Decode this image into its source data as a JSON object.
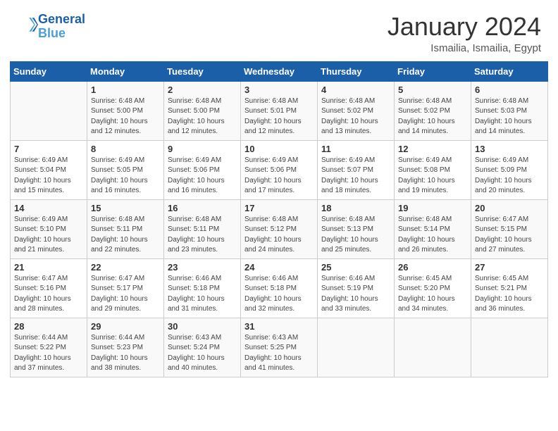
{
  "header": {
    "logo_line1": "General",
    "logo_line2": "Blue",
    "month": "January 2024",
    "location": "Ismailia, Ismailia, Egypt"
  },
  "days_of_week": [
    "Sunday",
    "Monday",
    "Tuesday",
    "Wednesday",
    "Thursday",
    "Friday",
    "Saturday"
  ],
  "weeks": [
    [
      {
        "num": "",
        "info": ""
      },
      {
        "num": "1",
        "info": "Sunrise: 6:48 AM\nSunset: 5:00 PM\nDaylight: 10 hours\nand 12 minutes."
      },
      {
        "num": "2",
        "info": "Sunrise: 6:48 AM\nSunset: 5:00 PM\nDaylight: 10 hours\nand 12 minutes."
      },
      {
        "num": "3",
        "info": "Sunrise: 6:48 AM\nSunset: 5:01 PM\nDaylight: 10 hours\nand 12 minutes."
      },
      {
        "num": "4",
        "info": "Sunrise: 6:48 AM\nSunset: 5:02 PM\nDaylight: 10 hours\nand 13 minutes."
      },
      {
        "num": "5",
        "info": "Sunrise: 6:48 AM\nSunset: 5:02 PM\nDaylight: 10 hours\nand 14 minutes."
      },
      {
        "num": "6",
        "info": "Sunrise: 6:48 AM\nSunset: 5:03 PM\nDaylight: 10 hours\nand 14 minutes."
      }
    ],
    [
      {
        "num": "7",
        "info": "Sunrise: 6:49 AM\nSunset: 5:04 PM\nDaylight: 10 hours\nand 15 minutes."
      },
      {
        "num": "8",
        "info": "Sunrise: 6:49 AM\nSunset: 5:05 PM\nDaylight: 10 hours\nand 16 minutes."
      },
      {
        "num": "9",
        "info": "Sunrise: 6:49 AM\nSunset: 5:06 PM\nDaylight: 10 hours\nand 16 minutes."
      },
      {
        "num": "10",
        "info": "Sunrise: 6:49 AM\nSunset: 5:06 PM\nDaylight: 10 hours\nand 17 minutes."
      },
      {
        "num": "11",
        "info": "Sunrise: 6:49 AM\nSunset: 5:07 PM\nDaylight: 10 hours\nand 18 minutes."
      },
      {
        "num": "12",
        "info": "Sunrise: 6:49 AM\nSunset: 5:08 PM\nDaylight: 10 hours\nand 19 minutes."
      },
      {
        "num": "13",
        "info": "Sunrise: 6:49 AM\nSunset: 5:09 PM\nDaylight: 10 hours\nand 20 minutes."
      }
    ],
    [
      {
        "num": "14",
        "info": "Sunrise: 6:49 AM\nSunset: 5:10 PM\nDaylight: 10 hours\nand 21 minutes."
      },
      {
        "num": "15",
        "info": "Sunrise: 6:48 AM\nSunset: 5:11 PM\nDaylight: 10 hours\nand 22 minutes."
      },
      {
        "num": "16",
        "info": "Sunrise: 6:48 AM\nSunset: 5:11 PM\nDaylight: 10 hours\nand 23 minutes."
      },
      {
        "num": "17",
        "info": "Sunrise: 6:48 AM\nSunset: 5:12 PM\nDaylight: 10 hours\nand 24 minutes."
      },
      {
        "num": "18",
        "info": "Sunrise: 6:48 AM\nSunset: 5:13 PM\nDaylight: 10 hours\nand 25 minutes."
      },
      {
        "num": "19",
        "info": "Sunrise: 6:48 AM\nSunset: 5:14 PM\nDaylight: 10 hours\nand 26 minutes."
      },
      {
        "num": "20",
        "info": "Sunrise: 6:47 AM\nSunset: 5:15 PM\nDaylight: 10 hours\nand 27 minutes."
      }
    ],
    [
      {
        "num": "21",
        "info": "Sunrise: 6:47 AM\nSunset: 5:16 PM\nDaylight: 10 hours\nand 28 minutes."
      },
      {
        "num": "22",
        "info": "Sunrise: 6:47 AM\nSunset: 5:17 PM\nDaylight: 10 hours\nand 29 minutes."
      },
      {
        "num": "23",
        "info": "Sunrise: 6:46 AM\nSunset: 5:18 PM\nDaylight: 10 hours\nand 31 minutes."
      },
      {
        "num": "24",
        "info": "Sunrise: 6:46 AM\nSunset: 5:18 PM\nDaylight: 10 hours\nand 32 minutes."
      },
      {
        "num": "25",
        "info": "Sunrise: 6:46 AM\nSunset: 5:19 PM\nDaylight: 10 hours\nand 33 minutes."
      },
      {
        "num": "26",
        "info": "Sunrise: 6:45 AM\nSunset: 5:20 PM\nDaylight: 10 hours\nand 34 minutes."
      },
      {
        "num": "27",
        "info": "Sunrise: 6:45 AM\nSunset: 5:21 PM\nDaylight: 10 hours\nand 36 minutes."
      }
    ],
    [
      {
        "num": "28",
        "info": "Sunrise: 6:44 AM\nSunset: 5:22 PM\nDaylight: 10 hours\nand 37 minutes."
      },
      {
        "num": "29",
        "info": "Sunrise: 6:44 AM\nSunset: 5:23 PM\nDaylight: 10 hours\nand 38 minutes."
      },
      {
        "num": "30",
        "info": "Sunrise: 6:43 AM\nSunset: 5:24 PM\nDaylight: 10 hours\nand 40 minutes."
      },
      {
        "num": "31",
        "info": "Sunrise: 6:43 AM\nSunset: 5:25 PM\nDaylight: 10 hours\nand 41 minutes."
      },
      {
        "num": "",
        "info": ""
      },
      {
        "num": "",
        "info": ""
      },
      {
        "num": "",
        "info": ""
      }
    ]
  ]
}
